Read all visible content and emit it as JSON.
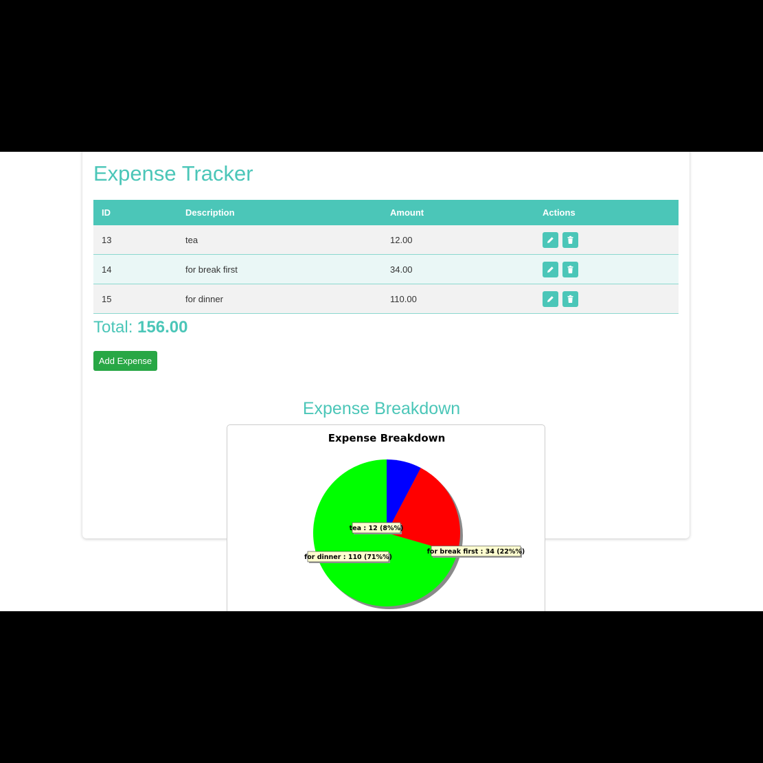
{
  "app": {
    "title": "Expense Tracker"
  },
  "table": {
    "headers": [
      "ID",
      "Description",
      "Amount",
      "Actions"
    ],
    "rows": [
      {
        "id": "13",
        "description": "tea",
        "amount": "12.00"
      },
      {
        "id": "14",
        "description": "for break first",
        "amount": "34.00"
      },
      {
        "id": "15",
        "description": "for dinner",
        "amount": "110.00"
      }
    ],
    "edit_icon": "pencil-icon",
    "delete_icon": "trash-icon"
  },
  "total": {
    "label": "Total: ",
    "value": "156.00"
  },
  "add_button": {
    "label": "Add Expense"
  },
  "breakdown": {
    "title": "Expense Breakdown"
  },
  "colors": {
    "accent": "#4bc6b8",
    "add_button": "#28a745"
  },
  "chart_data": {
    "type": "pie",
    "title": "Expense Breakdown",
    "categories": [
      "tea",
      "for break first",
      "for dinner"
    ],
    "values": [
      12,
      34,
      110
    ],
    "labels": [
      "tea : 12 (8%%)",
      "for break first : 34 (22%%)",
      "for dinner : 110 (71%%)"
    ],
    "colors": [
      "#0000ff",
      "#ff0000",
      "#00ff00"
    ]
  }
}
